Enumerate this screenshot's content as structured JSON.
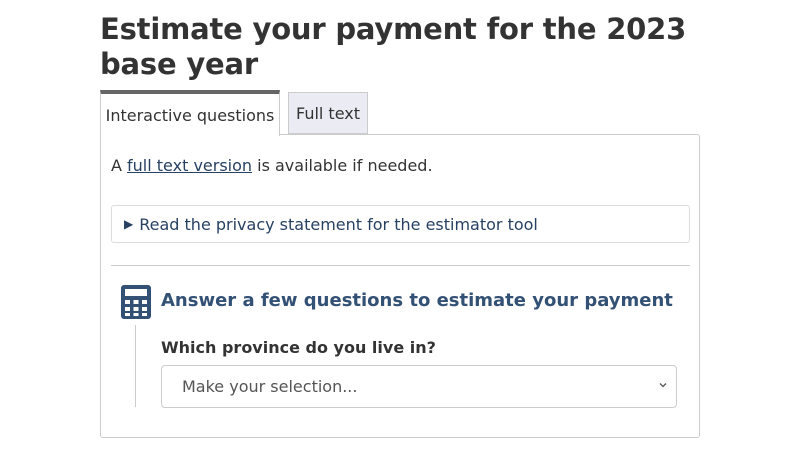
{
  "page": {
    "title": "Estimate your payment for the 2023 base year"
  },
  "tabs": [
    {
      "label": "Interactive questions",
      "active": true
    },
    {
      "label": "Full text",
      "active": false
    }
  ],
  "intro": {
    "prefix": "A ",
    "link_text": "full text version",
    "suffix": " is available if needed."
  },
  "privacy": {
    "summary": "Read the privacy statement for the estimator tool"
  },
  "question": {
    "icon": "calculator-icon",
    "heading": "Answer a few questions to estimate your payment",
    "label": "Which province do you live in?",
    "select_value": "Make your selection..."
  },
  "colors": {
    "heading_blue": "#335075",
    "link_blue": "#284162",
    "tab_inactive_bg": "#eaebf3",
    "active_tab_border": "#666666"
  }
}
